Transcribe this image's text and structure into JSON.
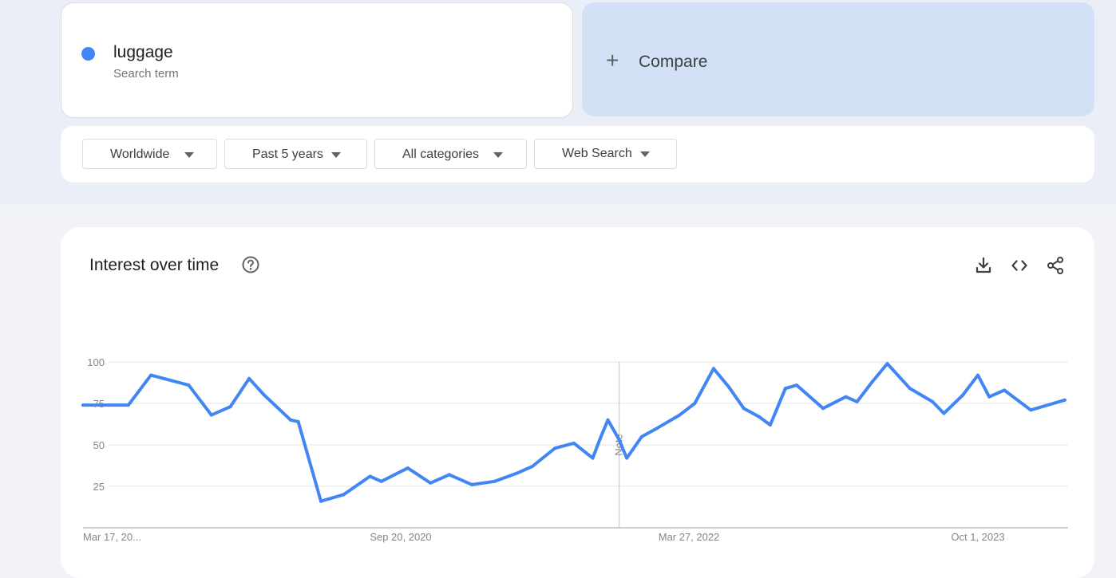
{
  "search_term": {
    "name": "luggage",
    "subtitle": "Search term",
    "color": "#4285f4"
  },
  "compare": {
    "label": "Compare",
    "icon": "plus-icon"
  },
  "filters": {
    "region": "Worldwide",
    "time_range": "Past 5 years",
    "category": "All categories",
    "search_type": "Web Search"
  },
  "interest_over_time": {
    "title": "Interest over time",
    "icons": [
      "help-icon",
      "download-icon",
      "embed-code-icon",
      "share-icon"
    ],
    "note_label": "Note"
  },
  "chart_data": {
    "type": "line",
    "x_tick_labels": [
      "Mar 17, 20...",
      "Sep 20, 2020",
      "Mar 27, 2022",
      "Oct 1, 2023"
    ],
    "y_ticks": [
      25,
      50,
      75,
      100
    ],
    "ylim": [
      0,
      100
    ],
    "grid": true,
    "legend": "none",
    "note_marker": {
      "date": "2021-12-05",
      "label": "Note"
    },
    "series": [
      {
        "color": "#4285f4",
        "x": [
          "2019-03-17",
          "2019-06-09",
          "2019-07-21",
          "2019-09-29",
          "2019-11-10",
          "2019-12-15",
          "2020-01-19",
          "2020-02-16",
          "2020-04-05",
          "2020-04-19",
          "2020-05-31",
          "2020-07-12",
          "2020-08-30",
          "2020-09-20",
          "2020-11-08",
          "2020-12-20",
          "2021-01-24",
          "2021-03-07",
          "2021-04-18",
          "2021-05-30",
          "2021-06-27",
          "2021-08-08",
          "2021-09-12",
          "2021-10-17",
          "2021-10-31",
          "2021-11-14",
          "2021-12-05",
          "2021-12-19",
          "2022-01-16",
          "2022-02-13",
          "2022-03-27",
          "2022-04-24",
          "2022-05-29",
          "2022-06-26",
          "2022-07-24",
          "2022-08-21",
          "2022-09-11",
          "2022-10-09",
          "2022-10-30",
          "2022-12-18",
          "2023-01-29",
          "2023-02-19",
          "2023-03-19",
          "2023-04-16",
          "2023-05-28",
          "2023-07-09",
          "2023-07-30",
          "2023-09-03",
          "2023-10-01",
          "2023-10-22",
          "2023-11-19",
          "2024-01-07",
          "2024-03-10"
        ],
        "values": [
          74,
          74,
          92,
          86,
          68,
          73,
          90,
          80,
          65,
          64,
          16,
          20,
          31,
          28,
          36,
          27,
          32,
          26,
          28,
          33,
          37,
          48,
          51,
          42,
          54,
          65,
          53,
          42,
          55,
          60,
          68,
          75,
          96,
          85,
          72,
          67,
          62,
          84,
          86,
          72,
          79,
          76,
          88,
          99,
          84,
          76,
          69,
          80,
          92,
          79,
          83,
          71,
          77
        ]
      }
    ]
  }
}
